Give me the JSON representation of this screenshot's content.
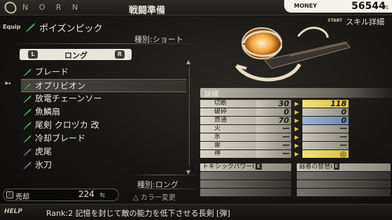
{
  "header": {
    "brand": "N O R N",
    "screen_title": "戦闘準備",
    "money_label": "MONEY",
    "money_value": "56544",
    "money_unit": "fc",
    "start_label": "START",
    "skill_detail_label": "スキル詳細"
  },
  "equipped": {
    "tag": "Equip",
    "name": "ポイズンピック",
    "type": "種別:ショート"
  },
  "tabs": {
    "left_button": "L",
    "label": "ロング",
    "right_button": "R"
  },
  "weapon_list": {
    "items": [
      {
        "name": "ブレード",
        "icon_color": "#6fd06a"
      },
      {
        "name": "オプリビオン",
        "icon_color": "#6fd06a"
      },
      {
        "name": "放電チェーンソー",
        "icon_color": "#6fd06a"
      },
      {
        "name": "魚鱗扇",
        "icon_color": "#6fd06a"
      },
      {
        "name": "尾剣 クロヅカ 改",
        "icon_color": "#6fd06a"
      },
      {
        "name": "冷却ブレード",
        "icon_color": "#6fd06a"
      },
      {
        "name": "虎尾",
        "icon_color": "#b57ae0"
      },
      {
        "name": "氷刀",
        "icon_color": "#b57ae0"
      }
    ],
    "selected_index": 1
  },
  "sell": {
    "button_icon": "○",
    "label": "売却",
    "value": "224",
    "unit": "fc"
  },
  "selected_type": "種別:ロング",
  "color_change": "△ カラー変更",
  "footer": {
    "help": "HELP",
    "description": "Rank:2 記憶を封じて敵の能力を低下させる長剣 [弾]"
  },
  "detail": {
    "header": "詳細",
    "stats": [
      {
        "label": "切断",
        "current": "30",
        "new": "118",
        "current_style": "neutral",
        "new_style": "hi-gold"
      },
      {
        "label": "破砕",
        "current": "0",
        "new": "0",
        "current_style": "neutral",
        "new_style": "neutral"
      },
      {
        "label": "貫通",
        "current": "70",
        "new": "0",
        "current_style": "neutral",
        "new_style": "hi-blue"
      },
      {
        "label": "火",
        "current": "ー",
        "new": "ー",
        "current_style": "neutral",
        "new_style": "neutral"
      },
      {
        "label": "氷",
        "current": "ー",
        "new": "ー",
        "current_style": "neutral",
        "new_style": "neutral"
      },
      {
        "label": "雷",
        "current": "ー",
        "new": "ー",
        "current_style": "neutral",
        "new_style": "neutral"
      },
      {
        "label": "神",
        "current": "ー",
        "new": "◎",
        "current_style": "neutral",
        "new_style": "hi-gold"
      }
    ],
    "skills_current": [
      {
        "name": "トキシックパワーⅠ",
        "badge": "E"
      }
    ],
    "skills_new": [
      {
        "name": "弱者の智慧Ⅰ",
        "badge": "E"
      }
    ]
  }
}
